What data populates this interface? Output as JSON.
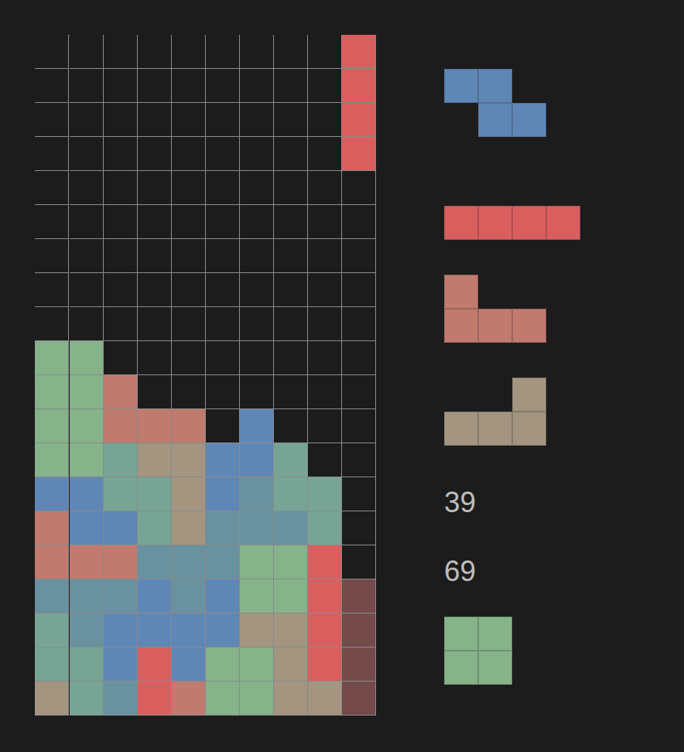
{
  "board": {
    "columns": 10,
    "rows": [
      [
        null,
        null,
        null,
        null,
        null,
        null,
        null,
        null,
        null,
        "#d95f5f"
      ],
      [
        null,
        null,
        null,
        null,
        null,
        null,
        null,
        null,
        null,
        "#d95f5f"
      ],
      [
        null,
        null,
        null,
        null,
        null,
        null,
        null,
        null,
        null,
        "#d95f5f"
      ],
      [
        null,
        null,
        null,
        null,
        null,
        null,
        null,
        null,
        null,
        "#d95f5f"
      ],
      [
        null,
        null,
        null,
        null,
        null,
        null,
        null,
        null,
        null,
        null
      ],
      [
        null,
        null,
        null,
        null,
        null,
        null,
        null,
        null,
        null,
        null
      ],
      [
        null,
        null,
        null,
        null,
        null,
        null,
        null,
        null,
        null,
        null
      ],
      [
        null,
        null,
        null,
        null,
        null,
        null,
        null,
        null,
        null,
        null
      ],
      [
        null,
        null,
        null,
        null,
        null,
        null,
        null,
        null,
        null,
        null
      ],
      [
        "#86b38a",
        "#86b38a",
        null,
        null,
        null,
        null,
        null,
        null,
        null,
        null
      ],
      [
        "#86b38a",
        "#86b38a",
        "#c07a6e",
        null,
        null,
        null,
        null,
        null,
        null,
        null
      ],
      [
        "#86b38a",
        "#86b38a",
        "#c07a6e",
        "#c07a6e",
        "#c07a6e",
        null,
        "#5f87b6",
        null,
        null,
        null
      ],
      [
        "#86b38a",
        "#86b38a",
        "#77a595",
        "#a39580",
        "#a39580",
        "#5f87b6",
        "#5f87b6",
        "#77a595",
        null,
        null
      ],
      [
        "#5f87b6",
        "#5f87b6",
        "#77a595",
        "#77a595",
        "#a39580",
        "#5f87b6",
        "#6892a0",
        "#77a595",
        "#77a595",
        null
      ],
      [
        "#c07a6e",
        "#5f87b6",
        "#5f87b6",
        "#77a595",
        "#a39580",
        "#6892a0",
        "#6892a0",
        "#6892a0",
        "#77a595",
        null
      ],
      [
        "#c07a6e",
        "#c07a6e",
        "#c07a6e",
        "#6892a0",
        "#6892a0",
        "#6892a0",
        "#86b38a",
        "#86b38a",
        "#d95f5f",
        null
      ],
      [
        "#6892a0",
        "#6892a0",
        "#6892a0",
        "#5f87b6",
        "#6892a0",
        "#5f87b6",
        "#86b38a",
        "#86b38a",
        "#d95f5f",
        "#744a4b"
      ],
      [
        "#77a595",
        "#6892a0",
        "#5f87b6",
        "#5f87b6",
        "#5f87b6",
        "#5f87b6",
        "#a39580",
        "#a39580",
        "#d95f5f",
        "#744a4b"
      ],
      [
        "#77a595",
        "#77a595",
        "#5f87b6",
        "#d95f5f",
        "#5f87b6",
        "#86b38a",
        "#86b38a",
        "#a39580",
        "#d95f5f",
        "#744a4b"
      ],
      [
        "#a39580",
        "#77a595",
        "#6892a0",
        "#d95f5f",
        "#c07a6e",
        "#86b38a",
        "#86b38a",
        "#a39580",
        "#a39580",
        "#744a4b"
      ]
    ]
  },
  "side": [
    {
      "kind": "piece",
      "color": "#5f87b6",
      "cells": [
        [
          1,
          1,
          0
        ],
        [
          0,
          1,
          1
        ]
      ]
    },
    {
      "kind": "piece",
      "color": "#d95f5f",
      "cells": [
        [
          1,
          1,
          1,
          1
        ]
      ]
    },
    {
      "kind": "piece",
      "color": "#c07a6e",
      "cells": [
        [
          1,
          0,
          0
        ],
        [
          1,
          1,
          1
        ]
      ]
    },
    {
      "kind": "piece",
      "color": "#a39580",
      "cells": [
        [
          0,
          0,
          1
        ],
        [
          1,
          1,
          1
        ]
      ]
    },
    {
      "kind": "number",
      "text": "39"
    },
    {
      "kind": "number",
      "text": "69"
    },
    {
      "kind": "piece",
      "color": "#86b38a",
      "cells": [
        [
          1,
          1
        ],
        [
          1,
          1
        ]
      ]
    }
  ]
}
